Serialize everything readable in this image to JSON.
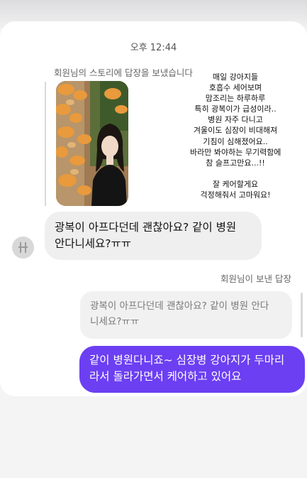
{
  "chat": {
    "timestamp": "오후 12:44",
    "story_reply_caption": "회원님의 스토리에 답장을 보냈습니다",
    "story_text_lines": [
      "매일 강아지들",
      "호흡수 세어보며",
      "맘조리는 하루하루",
      "특히 광복이가 급성이라..",
      "병원 자주 다니고",
      "겨울이도 심장이 비대해져",
      "기침이 심해졌어요..",
      "바라만 봐야하는 무기력함에",
      "참 슬프고만요...!!",
      "",
      "잘 케어할게요",
      "걱정해줘서 고마워요!"
    ],
    "received_message_lines": [
      "광복이 아프다던데 괜찮아요? 같이 병원",
      "안다니세요?ㅠㅠ"
    ],
    "reply_label": "회원님이 보낸 답장",
    "quoted_message_lines": [
      "광복이 아프다던데 괜찮아요? 같이 병원 안다",
      "니세요?ㅠㅠ"
    ],
    "sent_message_lines": [
      "같이 병원다니죠~ 심장병 강아지가 두마리",
      "라서 돌라가면서 케어하고 있어요"
    ]
  },
  "colors": {
    "sent_bubble": "#6c3ff2",
    "received_bubble": "#efeff0",
    "background": "#f4f4f5"
  },
  "icons": {
    "avatar": "default-profile-avatar"
  }
}
